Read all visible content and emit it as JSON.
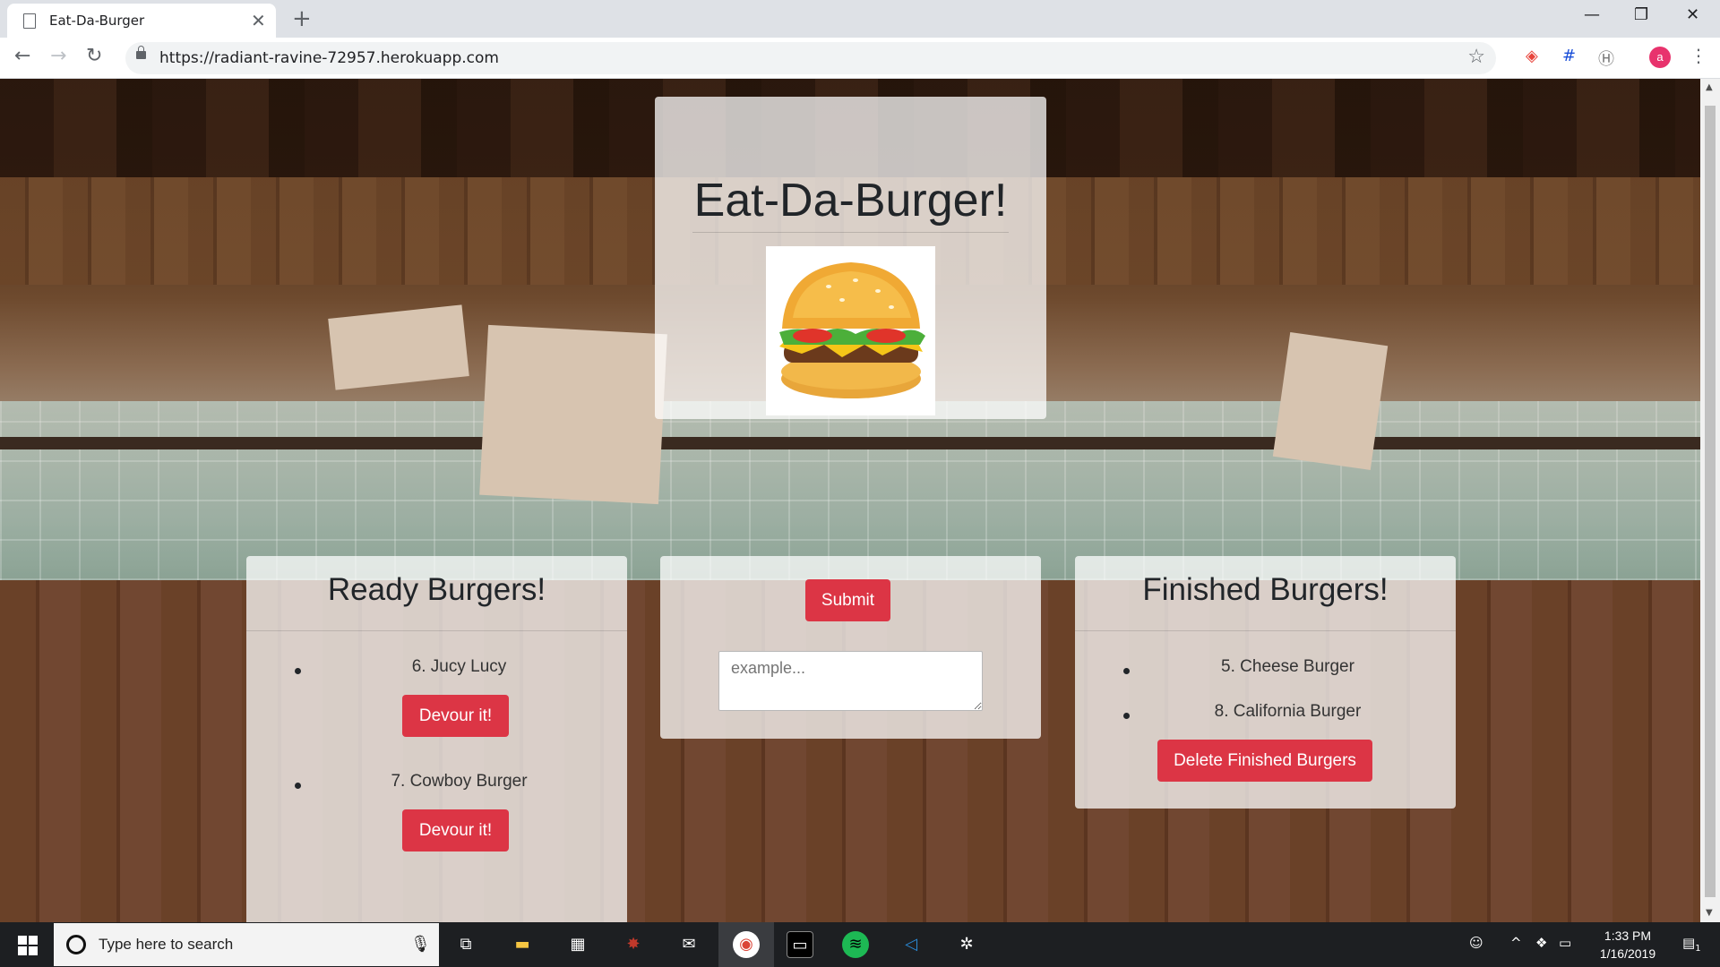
{
  "browser": {
    "tab_title": "Eat-Da-Burger",
    "tab_close": "✕",
    "new_tab": "+",
    "url": "https://radiant-ravine-72957.herokuapp.com",
    "avatar_letter": "a",
    "window_controls": {
      "minimize": "—",
      "maximize": "❐",
      "close": "✕"
    }
  },
  "page": {
    "title": "Eat-Da-Burger!",
    "ready": {
      "heading": "Ready Burgers!",
      "items": [
        {
          "label": "6. Jucy Lucy",
          "button": "Devour it!"
        },
        {
          "label": "7. Cowboy Burger",
          "button": "Devour it!"
        }
      ]
    },
    "form": {
      "submit_label": "Submit",
      "placeholder": "example..."
    },
    "finished": {
      "heading": "Finished Burgers!",
      "items": [
        "5. Cheese Burger",
        "8. California Burger"
      ],
      "delete_label": "Delete Finished Burgers"
    }
  },
  "taskbar": {
    "search_placeholder": "Type here to search",
    "time": "1:33 PM",
    "date": "1/16/2019",
    "notification_count": "1"
  },
  "colors": {
    "danger": "#dc3545",
    "panel_bg": "rgba(255,255,255,0.74)",
    "taskbar": "#1d1f22",
    "avatar": "#e8336d"
  }
}
